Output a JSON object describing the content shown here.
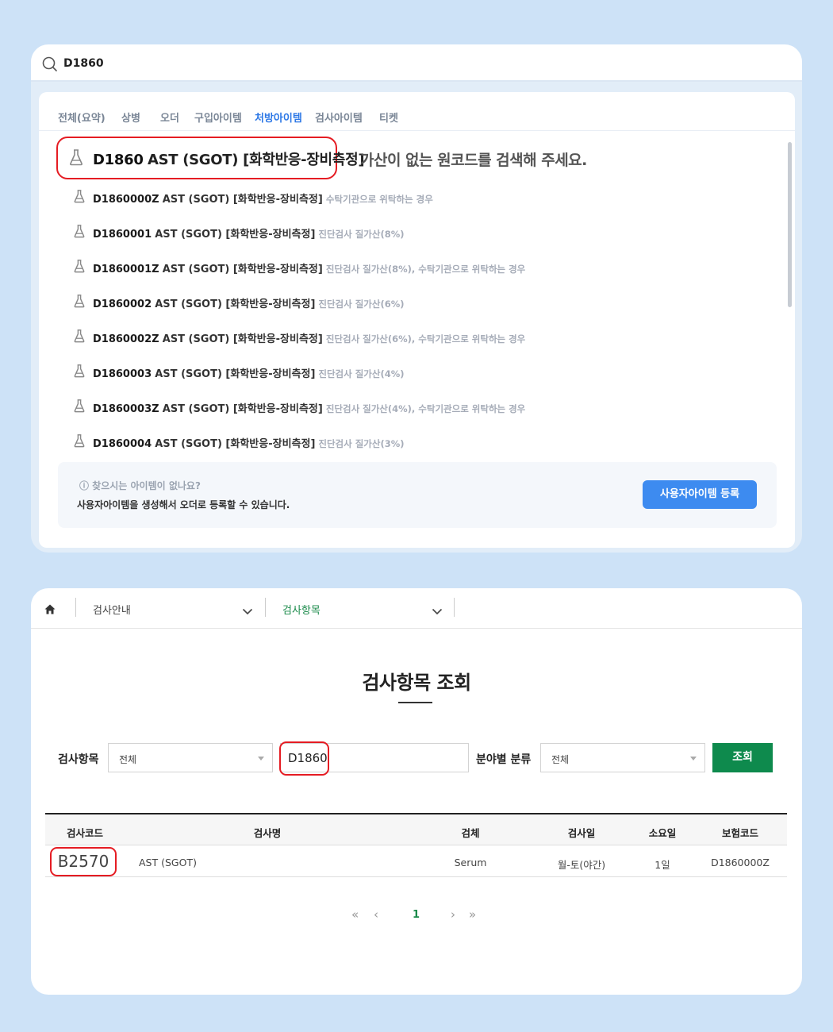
{
  "top": {
    "search_query": "D1860",
    "tabs": [
      {
        "label": "전체(요약)",
        "active": false
      },
      {
        "label": "상병",
        "active": false
      },
      {
        "label": "오더",
        "active": false
      },
      {
        "label": "구입아이템",
        "active": false
      },
      {
        "label": "처방아이템",
        "active": true
      },
      {
        "label": "검사아이템",
        "active": false
      },
      {
        "label": "티켓",
        "active": false
      }
    ],
    "first_result": {
      "code": "D1860",
      "name": "AST (SGOT) [화학반응-장비측정]"
    },
    "hint_text": "가산이 없는 원코드를 검색해 주세요.",
    "results": [
      {
        "code": "D1860000Z",
        "name": "AST (SGOT) [화학반응-장비측정]",
        "note": "수탁기관으로 위탁하는 경우"
      },
      {
        "code": "D1860001",
        "name": "AST (SGOT) [화학반응-장비측정]",
        "note": "진단검사 질가산(8%)"
      },
      {
        "code": "D1860001Z",
        "name": "AST (SGOT) [화학반응-장비측정]",
        "note": "진단검사 질가산(8%), 수탁기관으로 위탁하는 경우"
      },
      {
        "code": "D1860002",
        "name": "AST (SGOT) [화학반응-장비측정]",
        "note": "진단검사 질가산(6%)"
      },
      {
        "code": "D1860002Z",
        "name": "AST (SGOT) [화학반응-장비측정]",
        "note": "진단검사 질가산(6%), 수탁기관으로 위탁하는 경우"
      },
      {
        "code": "D1860003",
        "name": "AST (SGOT) [화학반응-장비측정]",
        "note": "진단검사 질가산(4%)"
      },
      {
        "code": "D1860003Z",
        "name": "AST (SGOT) [화학반응-장비측정]",
        "note": "진단검사 질가산(4%), 수탁기관으로 위탁하는 경우"
      },
      {
        "code": "D1860004",
        "name": "AST (SGOT) [화학반응-장비측정]",
        "note": "진단검사 질가산(3%)"
      }
    ],
    "notice": {
      "question": "ⓘ 찾으시는 아이템이 없나요?",
      "description": "사용자아이템을 생성해서 오더로 등록할 수 있습니다.",
      "button": "사용자아이템 등록"
    }
  },
  "bottom": {
    "breadcrumb": {
      "item1": "검사안내",
      "item2": "검사항목"
    },
    "title": "검사항목 조회",
    "filters": {
      "item_label": "검사항목",
      "item_select": "전체",
      "code_value": "D1860",
      "category_label": "분야별 분류",
      "category_select": "전체",
      "search_button": "조회"
    },
    "table": {
      "headers": [
        "검사코드",
        "검사명",
        "검체",
        "검사일",
        "소요일",
        "보험코드"
      ],
      "rows": [
        {
          "code": "B2570",
          "name": "AST (SGOT)",
          "specimen": "Serum",
          "test_day": "월-토(야간)",
          "duration": "1일",
          "insurance_code": "D1860000Z"
        }
      ]
    },
    "pagination": {
      "first": "«",
      "prev": "‹",
      "current": "1",
      "next": "›",
      "last": "»"
    }
  },
  "colors": {
    "background": "#cde2f7",
    "active_tab": "#2d78e6",
    "highlight_border": "#e51c23",
    "primary_button_blue": "#3d8bf0",
    "primary_button_green": "#0e8a4d",
    "breadcrumb_active": "#1a8a4a"
  },
  "icons": [
    "search-icon",
    "flask-icon",
    "home-icon",
    "chevron-down-icon"
  ]
}
